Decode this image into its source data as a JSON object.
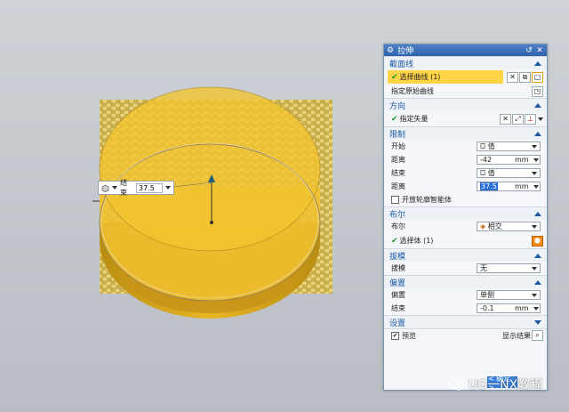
{
  "dialog": {
    "title": "拉伸",
    "sections": {
      "section_curve": {
        "header": "截面线",
        "select_curve_label": "选择曲线 (1)",
        "sketch_label": "指定原始曲线"
      },
      "direction": {
        "header": "方向",
        "vector_label": "指定矢量"
      },
      "limits": {
        "header": "限制",
        "start_label": "开始",
        "start_type": "值",
        "distance1_label": "距离",
        "distance1_value": "-42",
        "distance1_unit": "mm",
        "end_label": "结束",
        "end_type": "值",
        "distance2_label": "距离",
        "distance2_value": "37.5",
        "distance2_unit": "mm",
        "open_profile_label": "开放轮廓智能体"
      },
      "boolean": {
        "header": "布尔",
        "boolean_label": "布尔",
        "boolean_value": "相交",
        "select_body_label": "选择体 (1)"
      },
      "draft": {
        "header": "拔模",
        "draft_label": "拔模",
        "draft_value": "无"
      },
      "offset": {
        "header": "偏置",
        "offset_label": "偏置",
        "offset_value": "单侧",
        "end_label": "结束",
        "end_value": "-0.1",
        "end_unit": "mm"
      },
      "settings": {
        "header": "设置"
      }
    },
    "preview_label": "预览",
    "show_result_label": "显示结果",
    "ok_label": "< 确定 >"
  },
  "viewport": {
    "handle_label": "结束",
    "handle_value": "37.5"
  },
  "watermark": "UG一NX教程",
  "colors": {
    "accent": "#2f63ad",
    "section_header": "#1c58a3",
    "selection_highlight": "#ffd447",
    "model_yellow": "#f2c230",
    "check_green": "#1d9a2b"
  }
}
